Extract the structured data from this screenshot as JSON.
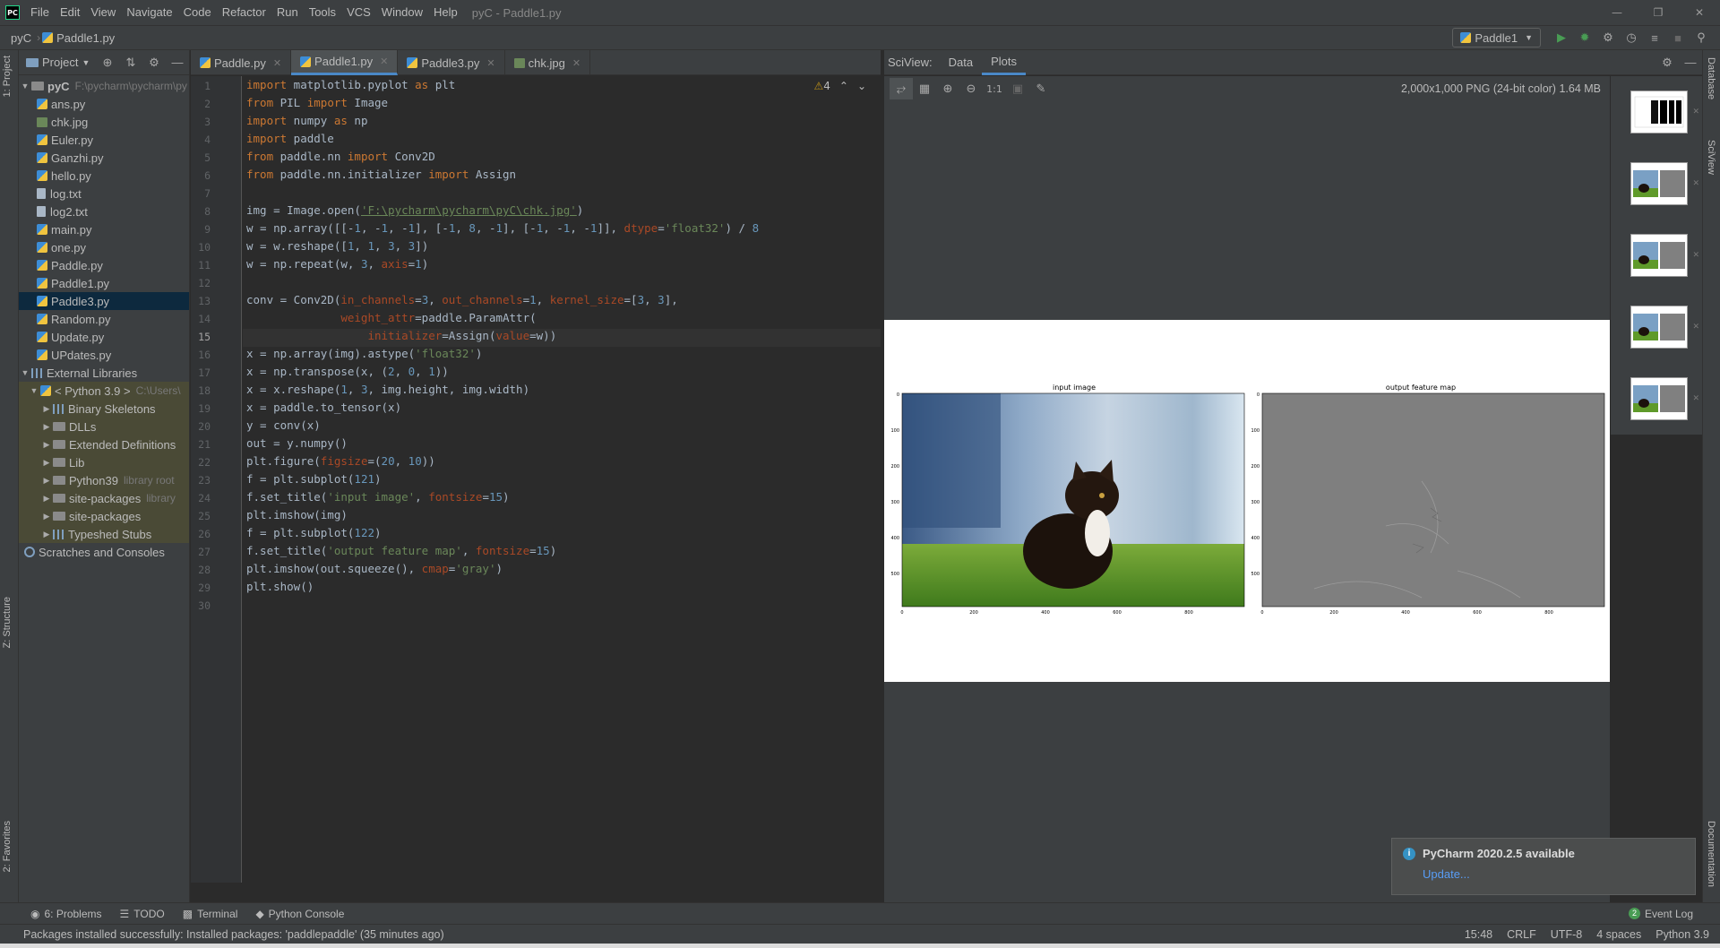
{
  "titlebar": {
    "menu": [
      "File",
      "Edit",
      "View",
      "Navigate",
      "Code",
      "Refactor",
      "Run",
      "Tools",
      "VCS",
      "Window",
      "Help"
    ],
    "title": "pyC - Paddle1.py"
  },
  "navbar": {
    "project": "pyC",
    "file": "Paddle1.py",
    "run_config": "Paddle1"
  },
  "left_strip": {
    "project_tab": "1: Project",
    "structure_tab": "Z: Structure",
    "favorites_tab": "2: Favorites"
  },
  "project": {
    "header": "Project",
    "root": {
      "name": "pyC",
      "path": "F:\\pycharm\\pycharm\\py"
    },
    "files": [
      "ans.py",
      "chk.jpg",
      "Euler.py",
      "Ganzhi.py",
      "hello.py",
      "log.txt",
      "log2.txt",
      "main.py",
      "one.py",
      "Paddle.py",
      "Paddle1.py",
      "Paddle3.py",
      "Random.py",
      "Update.py",
      "UPdates.py"
    ],
    "selected": "Paddle3.py",
    "external_libraries": "External Libraries",
    "python_sdk": {
      "name": "< Python 3.9 >",
      "path": "C:\\Users\\"
    },
    "sdk_children": [
      {
        "name": "Binary Skeletons",
        "hint": ""
      },
      {
        "name": "DLLs",
        "hint": ""
      },
      {
        "name": "Extended Definitions",
        "hint": ""
      },
      {
        "name": "Lib",
        "hint": ""
      },
      {
        "name": "Python39",
        "hint": "library root"
      },
      {
        "name": "site-packages",
        "hint": "library"
      },
      {
        "name": "site-packages",
        "hint": ""
      },
      {
        "name": "Typeshed Stubs",
        "hint": ""
      }
    ],
    "scratches": "Scratches and Consoles"
  },
  "editor": {
    "tabs": [
      "Paddle.py",
      "Paddle1.py",
      "Paddle3.py",
      "chk.jpg"
    ],
    "active_tab": "Paddle1.py",
    "warnings": "4",
    "current_line": 15,
    "line_numbers": [
      "1",
      "2",
      "3",
      "4",
      "5",
      "6",
      "7",
      "8",
      "9",
      "10",
      "11",
      "12",
      "13",
      "14",
      "15",
      "16",
      "17",
      "18",
      "19",
      "20",
      "21",
      "22",
      "23",
      "24",
      "25",
      "26",
      "27",
      "28",
      "29",
      "30"
    ],
    "code": {
      "l1": [
        "import",
        " matplotlib.pyplot ",
        "as",
        " plt"
      ],
      "l2": [
        "from",
        " PIL ",
        "import",
        " Image"
      ],
      "l3": [
        "import",
        " numpy ",
        "as",
        " np"
      ],
      "l4": [
        "import",
        " paddle"
      ],
      "l5": [
        "from",
        " paddle.nn ",
        "import",
        " Conv2D"
      ],
      "l6": [
        "from",
        " paddle.nn.initializer ",
        "import",
        " Assign"
      ],
      "l8": [
        "img = Image.open(",
        "'F:\\pycharm\\pycharm\\pyC\\chk.jpg'",
        ")"
      ],
      "l9": [
        "w = np.array([[-",
        "1",
        ", -",
        "1",
        ", -",
        "1",
        "], [-",
        "1",
        ", ",
        "8",
        ", -",
        "1",
        "], [-",
        "1",
        ", -",
        "1",
        ", -",
        "1",
        "]], ",
        "dtype",
        "=",
        "'float32'",
        ") / ",
        "8"
      ],
      "l10": [
        "w = w.reshape([",
        "1",
        ", ",
        "1",
        ", ",
        "3",
        ", ",
        "3",
        "])"
      ],
      "l11": [
        "w = np.repeat(w, ",
        "3",
        ", ",
        "axis",
        "=",
        "1",
        ")"
      ],
      "l13": [
        "conv = Conv2D(",
        "in_channels",
        "=",
        "3",
        ", ",
        "out_channels",
        "=",
        "1",
        ", ",
        "kernel_size",
        "=[",
        "3",
        ", ",
        "3",
        "],"
      ],
      "l14": [
        "              ",
        "weight_attr",
        "=paddle.ParamAttr("
      ],
      "l15": [
        "                  ",
        "initializer",
        "=Assign(",
        "value",
        "=w))"
      ],
      "l16": [
        "x = np.array(img).astype(",
        "'float32'",
        ")"
      ],
      "l17": [
        "x = np.transpose(x, (",
        "2",
        ", ",
        "0",
        ", ",
        "1",
        "))"
      ],
      "l18": [
        "x = x.reshape(",
        "1",
        ", ",
        "3",
        ", img.height, img.width)"
      ],
      "l19": [
        "x = paddle.to_tensor(x)"
      ],
      "l20": [
        "y = conv(x)"
      ],
      "l21": [
        "out = y.numpy()"
      ],
      "l22": [
        "plt.figure(",
        "figsize",
        "=(",
        "20",
        ", ",
        "10",
        "))"
      ],
      "l23": [
        "f = plt.subplot(",
        "121",
        ")"
      ],
      "l24": [
        "f.set_title(",
        "'input image'",
        ", ",
        "fontsize",
        "=",
        "15",
        ")"
      ],
      "l25": [
        "plt.imshow(img)"
      ],
      "l26": [
        "f = plt.subplot(",
        "122",
        ")"
      ],
      "l27": [
        "f.set_title(",
        "'output feature map'",
        ", ",
        "fontsize",
        "=",
        "15",
        ")"
      ],
      "l28": [
        "plt.imshow(out.squeeze(), ",
        "cmap",
        "=",
        "'gray'",
        ")"
      ],
      "l29": [
        "plt.show()"
      ]
    }
  },
  "sciview": {
    "label": "SciView:",
    "tabs": [
      "Data",
      "Plots"
    ],
    "active_tab": "Plots",
    "image_info": "2,000x1,000 PNG (24-bit color) 1.64 MB",
    "zoom_label": "1:1",
    "plot": {
      "left_title": "input image",
      "right_title": "output feature map",
      "y_ticks": [
        "0",
        "100",
        "200",
        "300",
        "400",
        "500"
      ],
      "x_ticks": [
        "0",
        "200",
        "400",
        "600",
        "800"
      ]
    },
    "thumbnail_count": 5
  },
  "right_strip": {
    "database_tab": "Database",
    "sciview_tab": "SciView",
    "documentation_tab": "Documentation"
  },
  "tool_windows": {
    "problems": "6: Problems",
    "todo": "TODO",
    "terminal": "Terminal",
    "python_console": "Python Console",
    "event_log_count": "2",
    "event_log": "Event Log"
  },
  "status": {
    "message": "Packages installed successfully: Installed packages: 'paddlepaddle' (35 minutes ago)",
    "time": "15:48",
    "line_sep": "CRLF",
    "encoding": "UTF-8",
    "indent": "4 spaces",
    "interpreter": "Python 3.9"
  },
  "notification": {
    "title": "PyCharm 2020.2.5 available",
    "link": "Update..."
  },
  "colors": {
    "accent": "#4a88c7",
    "keyword": "#cc7832",
    "string": "#6a8759",
    "number": "#6897bb",
    "param": "#aa4926",
    "background": "#2b2b2b",
    "panel": "#3c3f41"
  }
}
